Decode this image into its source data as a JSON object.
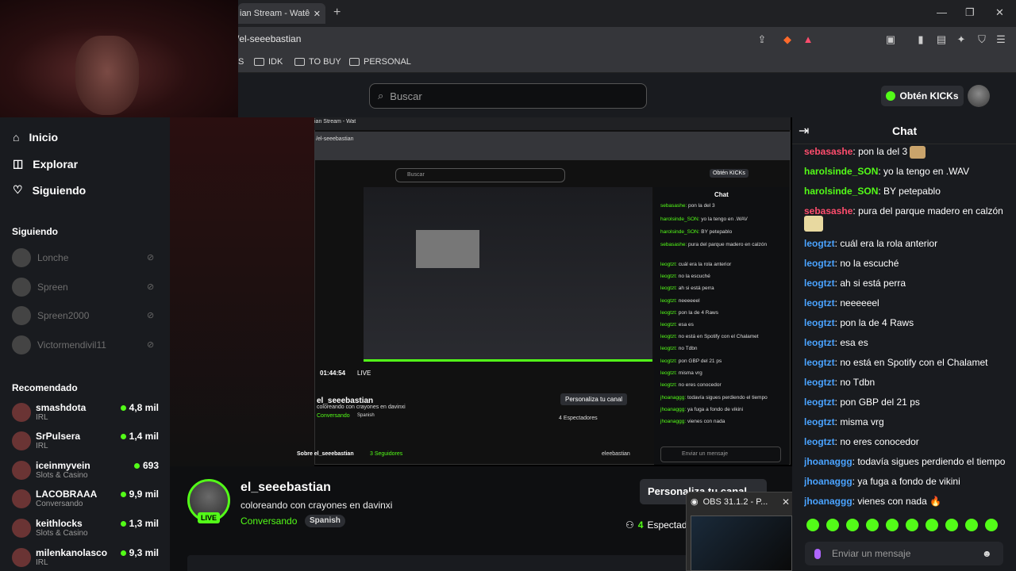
{
  "browser": {
    "tab_title": "ian Stream - Watê",
    "tab_close": "✕",
    "new_tab": "+",
    "url": "/el-seeebastian",
    "bookmarks": [
      "S",
      "IDK",
      "TO BUY",
      "PERSONAL"
    ],
    "window_controls": [
      "—",
      "❐",
      "✕"
    ]
  },
  "header": {
    "search_placeholder": "Buscar",
    "kicks_button": "Obtén KICKs"
  },
  "sidebar": {
    "nav": [
      {
        "label": "Inicio",
        "icon": "home-icon"
      },
      {
        "label": "Explorar",
        "icon": "compass-icon"
      },
      {
        "label": "Siguiendo",
        "icon": "heart-icon"
      }
    ],
    "following_title": "Siguiendo",
    "following": [
      "Lonche",
      "Spreen",
      "Spreen2000",
      "Victormendivil11"
    ],
    "recommended_title": "Recomendado",
    "recommended": [
      {
        "name": "smashdota",
        "category": "IRL",
        "viewers": "4,8 mil"
      },
      {
        "name": "SrPulsera",
        "category": "IRL",
        "viewers": "1,4 mil"
      },
      {
        "name": "iceinmyvein",
        "category": "Slots & Casino",
        "viewers": "693"
      },
      {
        "name": "LACOBRAAA",
        "category": "Conversando",
        "viewers": "9,9 mil"
      },
      {
        "name": "keithlocks",
        "category": "Slots & Casino",
        "viewers": "1,3 mil"
      },
      {
        "name": "milenkanolasco",
        "category": "IRL",
        "viewers": "9,3 mil"
      }
    ]
  },
  "video": {
    "inner_tab": "ian Stream - Wat",
    "inner_url": "/el-seeebastian",
    "inner_search": "Buscar",
    "inner_kicks": "Obtén KICKs",
    "inner_chat_title": "Chat",
    "inner_channel": "el_seeebastian",
    "inner_title": "coloreando con crayones en davinxi",
    "inner_category": "Conversando",
    "inner_lang": "Spanish",
    "inner_personalize": "Personaliza tu canal",
    "inner_viewers": "4 Espectadores",
    "inner_about": "Sobre el_seeebastian",
    "inner_followers": "3 Seguidores",
    "inner_social": "eleebastian",
    "inner_time": "01:44:54",
    "inner_live": "LIVE",
    "inner_chat_input": "Enviar un mensaje"
  },
  "channel": {
    "name": "el_seeebastian",
    "title": "coloreando con crayones en davinxi",
    "category": "Conversando",
    "language": "Spanish",
    "live": "LIVE",
    "personalize": "Personaliza tu canal",
    "viewers_count": "4",
    "viewers_label": "Espectadores"
  },
  "obs": {
    "title": "OBS 31.1.2 - P...",
    "close": "✕"
  },
  "chat": {
    "title": "Chat",
    "messages": [
      {
        "user": "sebasashe",
        "color": "red",
        "text": "pon la del 3"
      },
      {
        "user": "harolsinde_SON",
        "color": "green",
        "text": "yo la tengo en .WAV"
      },
      {
        "user": "harolsinde_SON",
        "color": "green",
        "text": "BY petepablo"
      },
      {
        "user": "sebasashe",
        "color": "red",
        "text": "pura del parque madero en calzón"
      },
      {
        "user": "leogtzt",
        "color": "blue",
        "text": "cuál era la rola anterior"
      },
      {
        "user": "leogtzt",
        "color": "blue",
        "text": "no la escuché"
      },
      {
        "user": "leogtzt",
        "color": "blue",
        "text": "ah si está perra"
      },
      {
        "user": "leogtzt",
        "color": "blue",
        "text": "neeeeeel"
      },
      {
        "user": "leogtzt",
        "color": "blue",
        "text": "pon la de 4 Raws"
      },
      {
        "user": "leogtzt",
        "color": "blue",
        "text": "esa es"
      },
      {
        "user": "leogtzt",
        "color": "blue",
        "text": "no está en Spotify con el Chalamet"
      },
      {
        "user": "leogtzt",
        "color": "blue",
        "text": "no Tdbn"
      },
      {
        "user": "leogtzt",
        "color": "blue",
        "text": "pon GBP del 21 ps"
      },
      {
        "user": "leogtzt",
        "color": "blue",
        "text": "misma vrg"
      },
      {
        "user": "leogtzt",
        "color": "blue",
        "text": "no eres conocedor"
      },
      {
        "user": "jhoanaggg",
        "color": "blue",
        "text": "todavía sigues perdiendo el tiempo"
      },
      {
        "user": "jhoanaggg",
        "color": "blue",
        "text": "ya fuga a fondo de vikini"
      },
      {
        "user": "jhoanaggg",
        "color": "blue",
        "text": "vienes con nada 🔥"
      }
    ],
    "input_placeholder": "Enviar un mensaje"
  },
  "colors": {
    "accent": "#53fc18",
    "bg": "#0e0f11",
    "panel": "#191b1f"
  }
}
